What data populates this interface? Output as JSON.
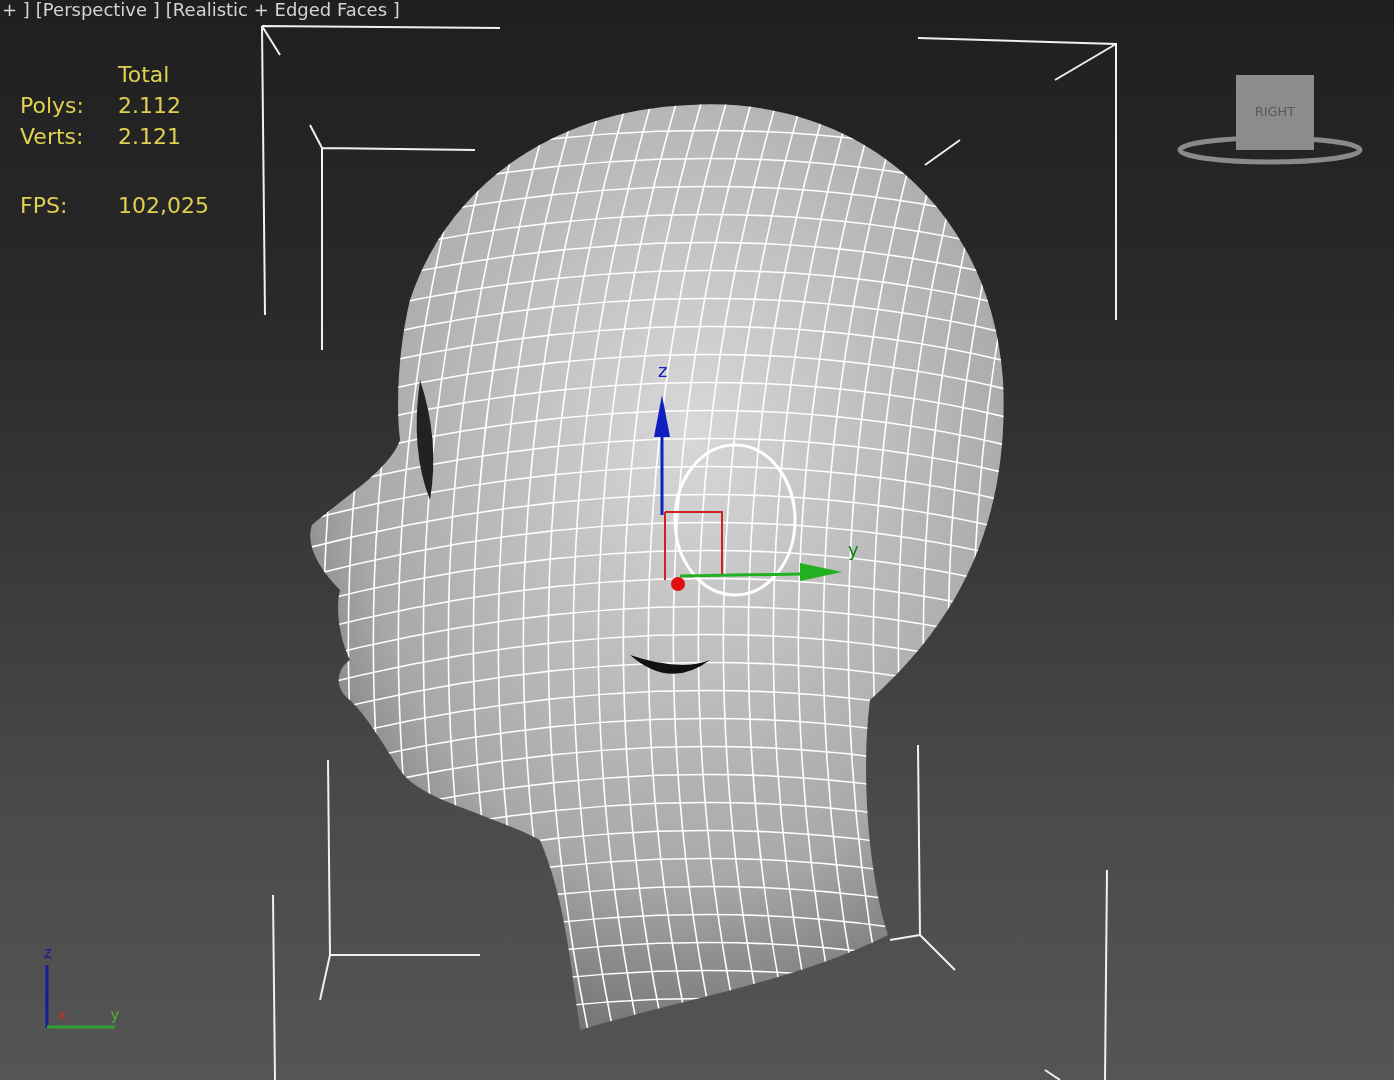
{
  "viewport": {
    "labels": [
      "+ ]",
      "[Perspective ]",
      "[Realistic + Edged Faces ]"
    ],
    "stats": {
      "header": "Total",
      "rows": [
        {
          "label": "Polys:",
          "value": "2.112"
        },
        {
          "label": "Verts:",
          "value": "2.121"
        }
      ],
      "fps": {
        "label": "FPS:",
        "value": "102,025"
      }
    },
    "view_cube": {
      "face": "RIGHT"
    },
    "gizmo": {
      "z": "z",
      "y": "y"
    },
    "corner_axes": {
      "z": "z",
      "x": "x",
      "y": "y"
    }
  }
}
